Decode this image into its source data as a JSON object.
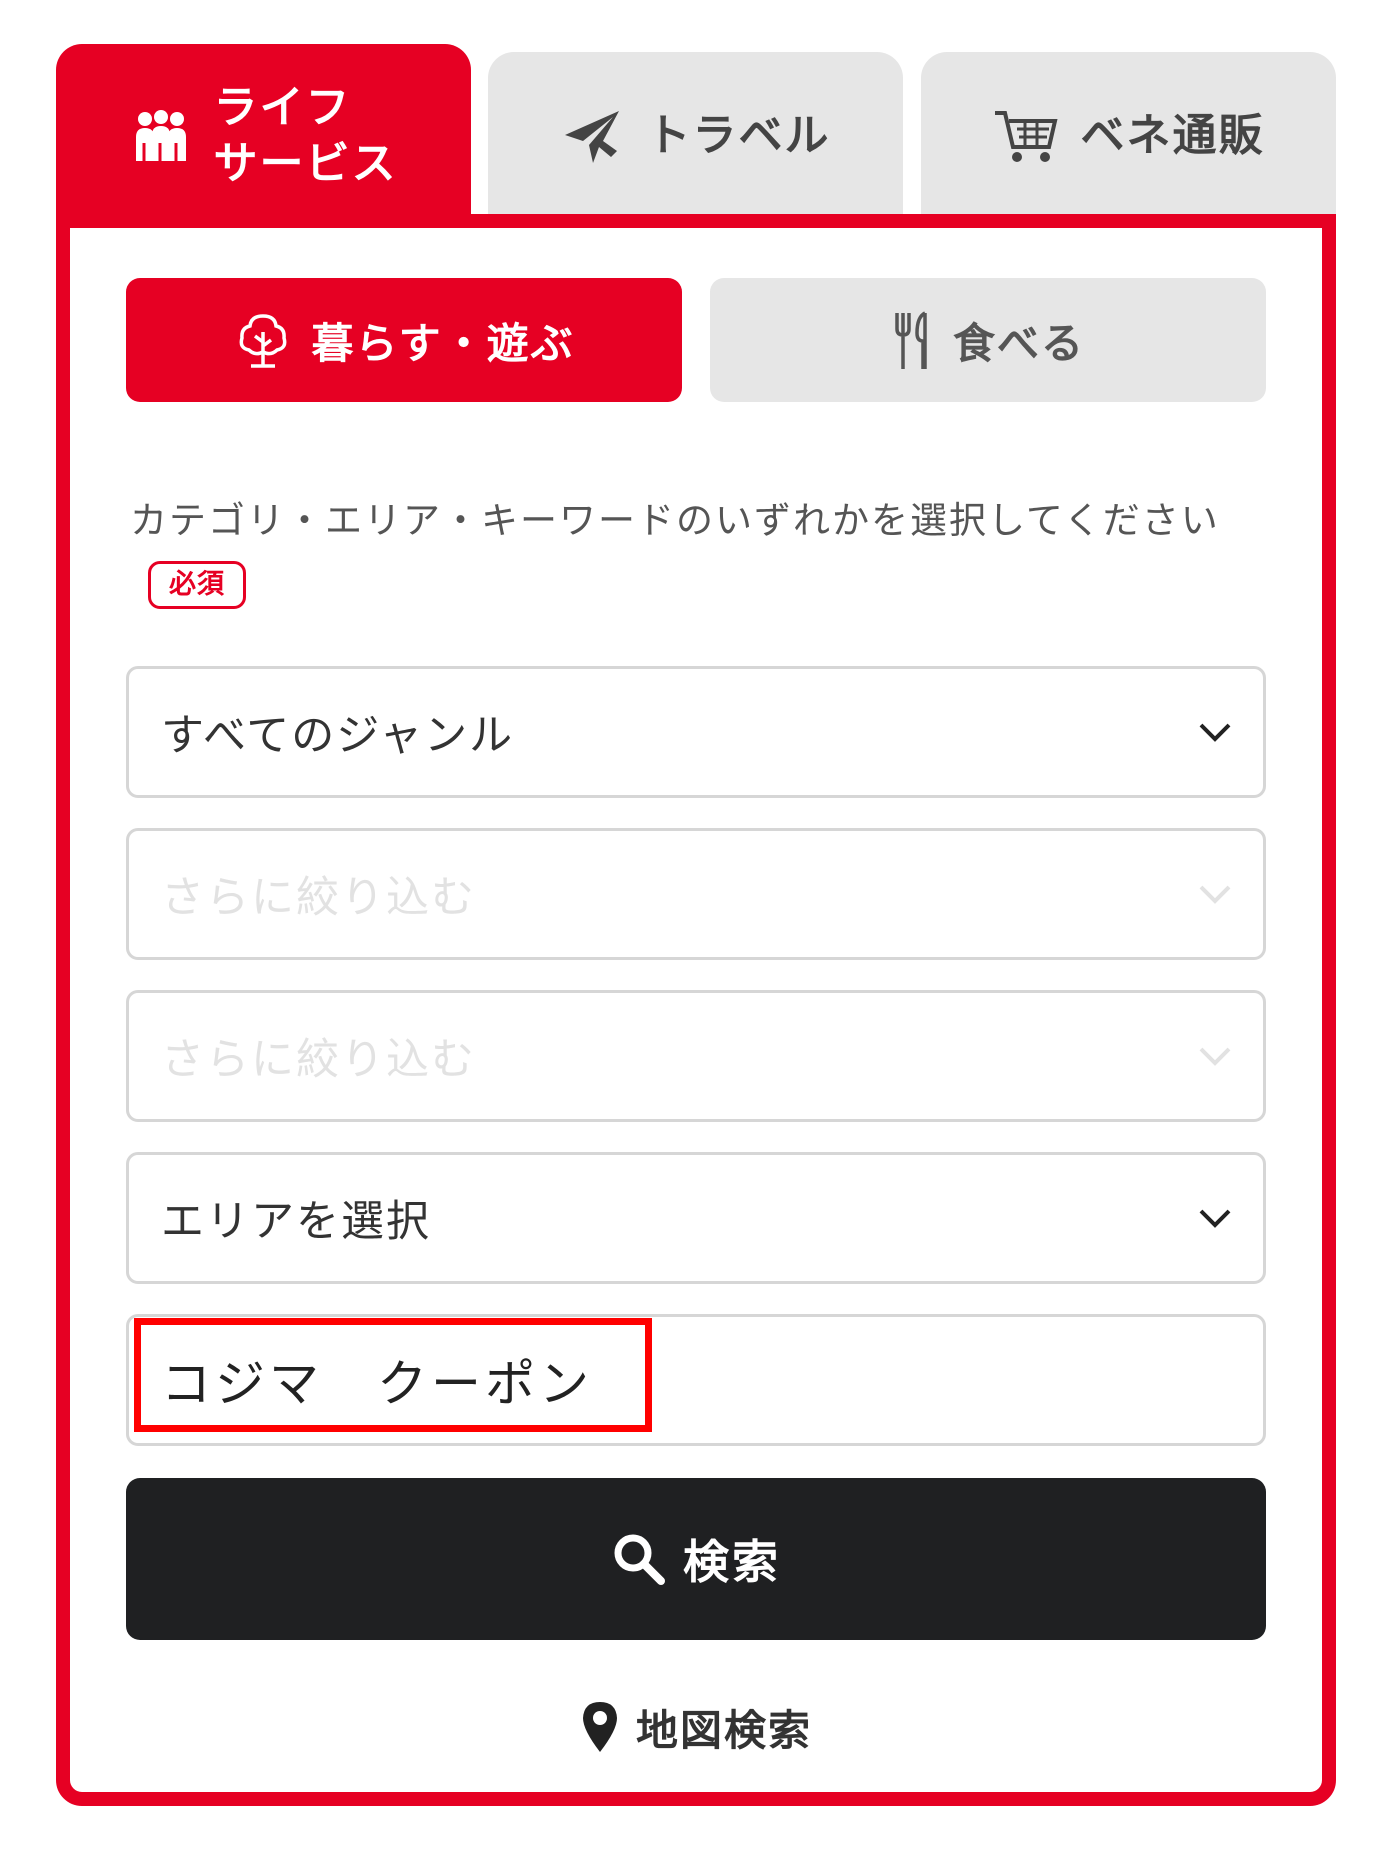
{
  "tabs": [
    {
      "label": "ライフ\nサービス",
      "icon": "family-icon",
      "active": true
    },
    {
      "label": "トラベル",
      "icon": "airplane-icon",
      "active": false
    },
    {
      "label": "ベネ通販",
      "icon": "cart-icon",
      "active": false
    }
  ],
  "subtabs": [
    {
      "label": "暮らす・遊ぶ",
      "icon": "tree-icon",
      "active": true
    },
    {
      "label": "食べる",
      "icon": "fork-knife-icon",
      "active": false
    }
  ],
  "instruction": {
    "text": "カテゴリ・エリア・キーワードのいずれかを選択してください",
    "badge": "必須"
  },
  "fields": {
    "genre": {
      "value": "すべてのジャンル"
    },
    "refine1": {
      "value": "さらに絞り込む"
    },
    "refine2": {
      "value": "さらに絞り込む"
    },
    "area": {
      "value": "エリアを選択"
    },
    "keyword": {
      "value": "コジマ　クーポン"
    }
  },
  "search_button": {
    "label": "検索",
    "icon": "search-icon"
  },
  "map_search": {
    "label": "地図検索",
    "icon": "map-pin-icon"
  },
  "colors": {
    "accent": "#e60023",
    "button": "#1f2022",
    "inactive_tab": "#e6e6e6"
  }
}
